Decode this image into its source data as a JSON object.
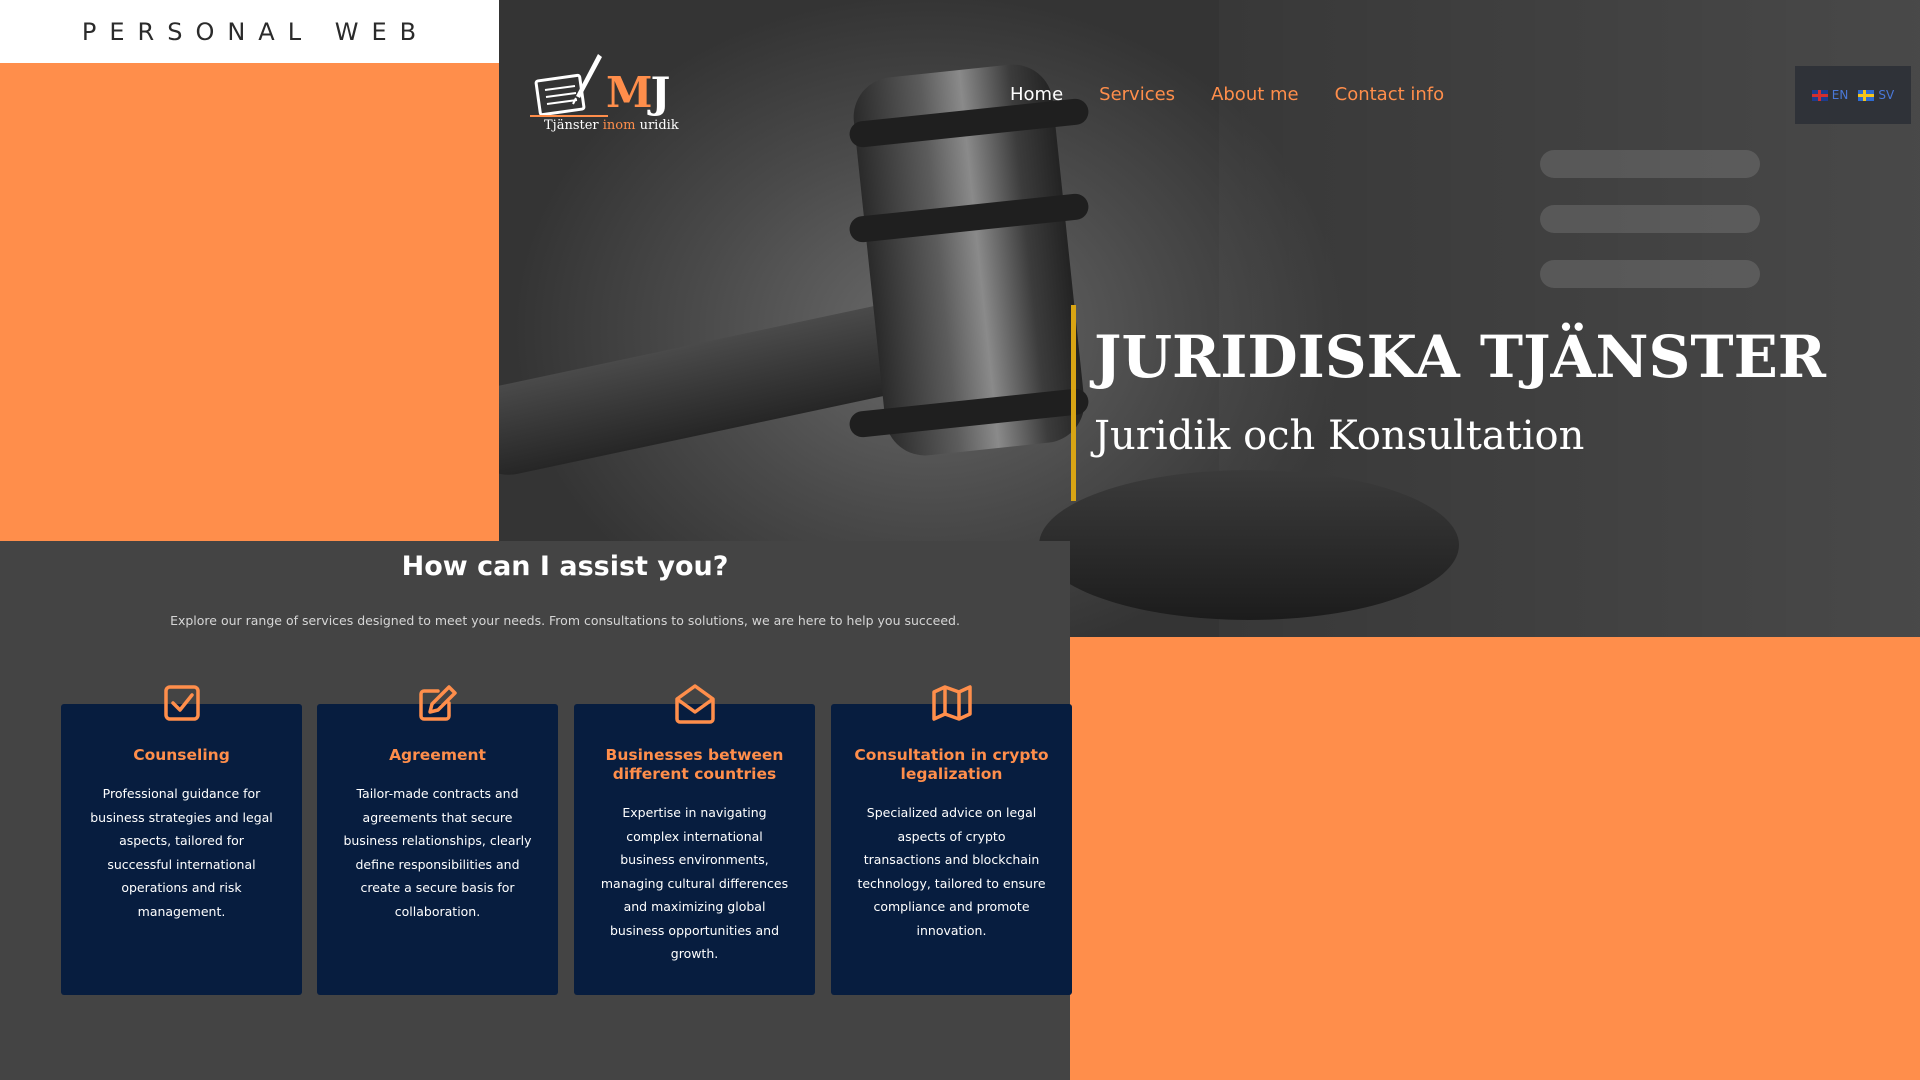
{
  "site": {
    "brand": "PERSONAL WEB"
  },
  "logo": {
    "initial_m": "M",
    "initial_j": "J",
    "tagline_a": "Tjänster ",
    "tagline_b": "inom",
    "tagline_c": " ",
    "tagline_d": "uridik"
  },
  "nav": {
    "items": [
      {
        "label": "Home",
        "active": true
      },
      {
        "label": "Services"
      },
      {
        "label": "About me"
      },
      {
        "label": "Contact info"
      }
    ]
  },
  "language": {
    "en": "EN",
    "sv": "SV"
  },
  "hero": {
    "title": "JURIDISKA TJÄNSTER",
    "subtitle": "Juridik och Konsultation"
  },
  "services": {
    "heading": "How can I assist you?",
    "intro": "Explore our range of services designed to meet your needs. From consultations to solutions, we are here to help you succeed.",
    "cards": [
      {
        "icon": "checkbox-icon",
        "title": "Counseling",
        "text": "Professional guidance for business strategies and legal aspects, tailored for successful international operations and risk management."
      },
      {
        "icon": "edit-icon",
        "title": "Agreement",
        "text": "Tailor-made contracts and agreements that secure business relationships, clearly define responsibilities and create a secure basis for collaboration."
      },
      {
        "icon": "open-envelope-icon",
        "title": "Businesses between different countries",
        "text": "Expertise in navigating complex international business environments, managing cultural differences and maximizing global business opportunities and growth."
      },
      {
        "icon": "map-icon",
        "title": "Consultation in crypto legalization",
        "text": "Specialized advice on legal aspects of crypto transactions and blockchain technology, tailored to ensure compliance and promote innovation."
      }
    ]
  },
  "colors": {
    "accent": "#ff8e4b",
    "card_bg": "#071d3f",
    "section_bg": "#444444",
    "hero_bar": "#d9a514"
  }
}
